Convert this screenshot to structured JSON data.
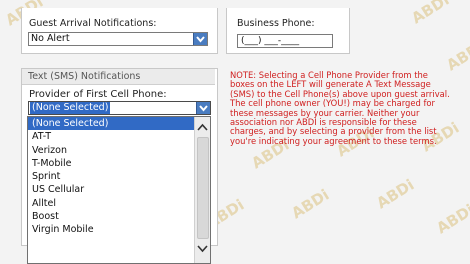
{
  "guest_arrival": {
    "label": "Guest Arrival Notifications:",
    "selected": "No Alert"
  },
  "business_phone": {
    "label": "Business Phone:",
    "value": "(___) ___-____"
  },
  "sms_section": {
    "title": "Text (SMS) Notifications",
    "provider_label": "Provider of First Cell Phone:",
    "selected": "(None Selected)",
    "options": [
      "(None Selected)",
      "AT-T",
      "Verizon",
      "T-Mobile",
      "Sprint",
      "US Cellular",
      "Alltel",
      "Boost",
      "Virgin Mobile"
    ]
  },
  "note_text": "NOTE: Selecting a Cell Phone Provider from the boxes on the LEFT will generate A Text Message (SMS) to the Cell Phone(s) above upon guest arrival. The cell phone owner (YOU!) may be charged for these messages by your carrier. Neither your association nor ABDI is responsible for these charges, and by selecting a provider from the list you're indicating your agreement to these terms.",
  "watermark_text": "ABDi",
  "colors": {
    "dropdown_button": "#4a7cc0",
    "selection": "#316ac5",
    "note": "#d02020"
  }
}
